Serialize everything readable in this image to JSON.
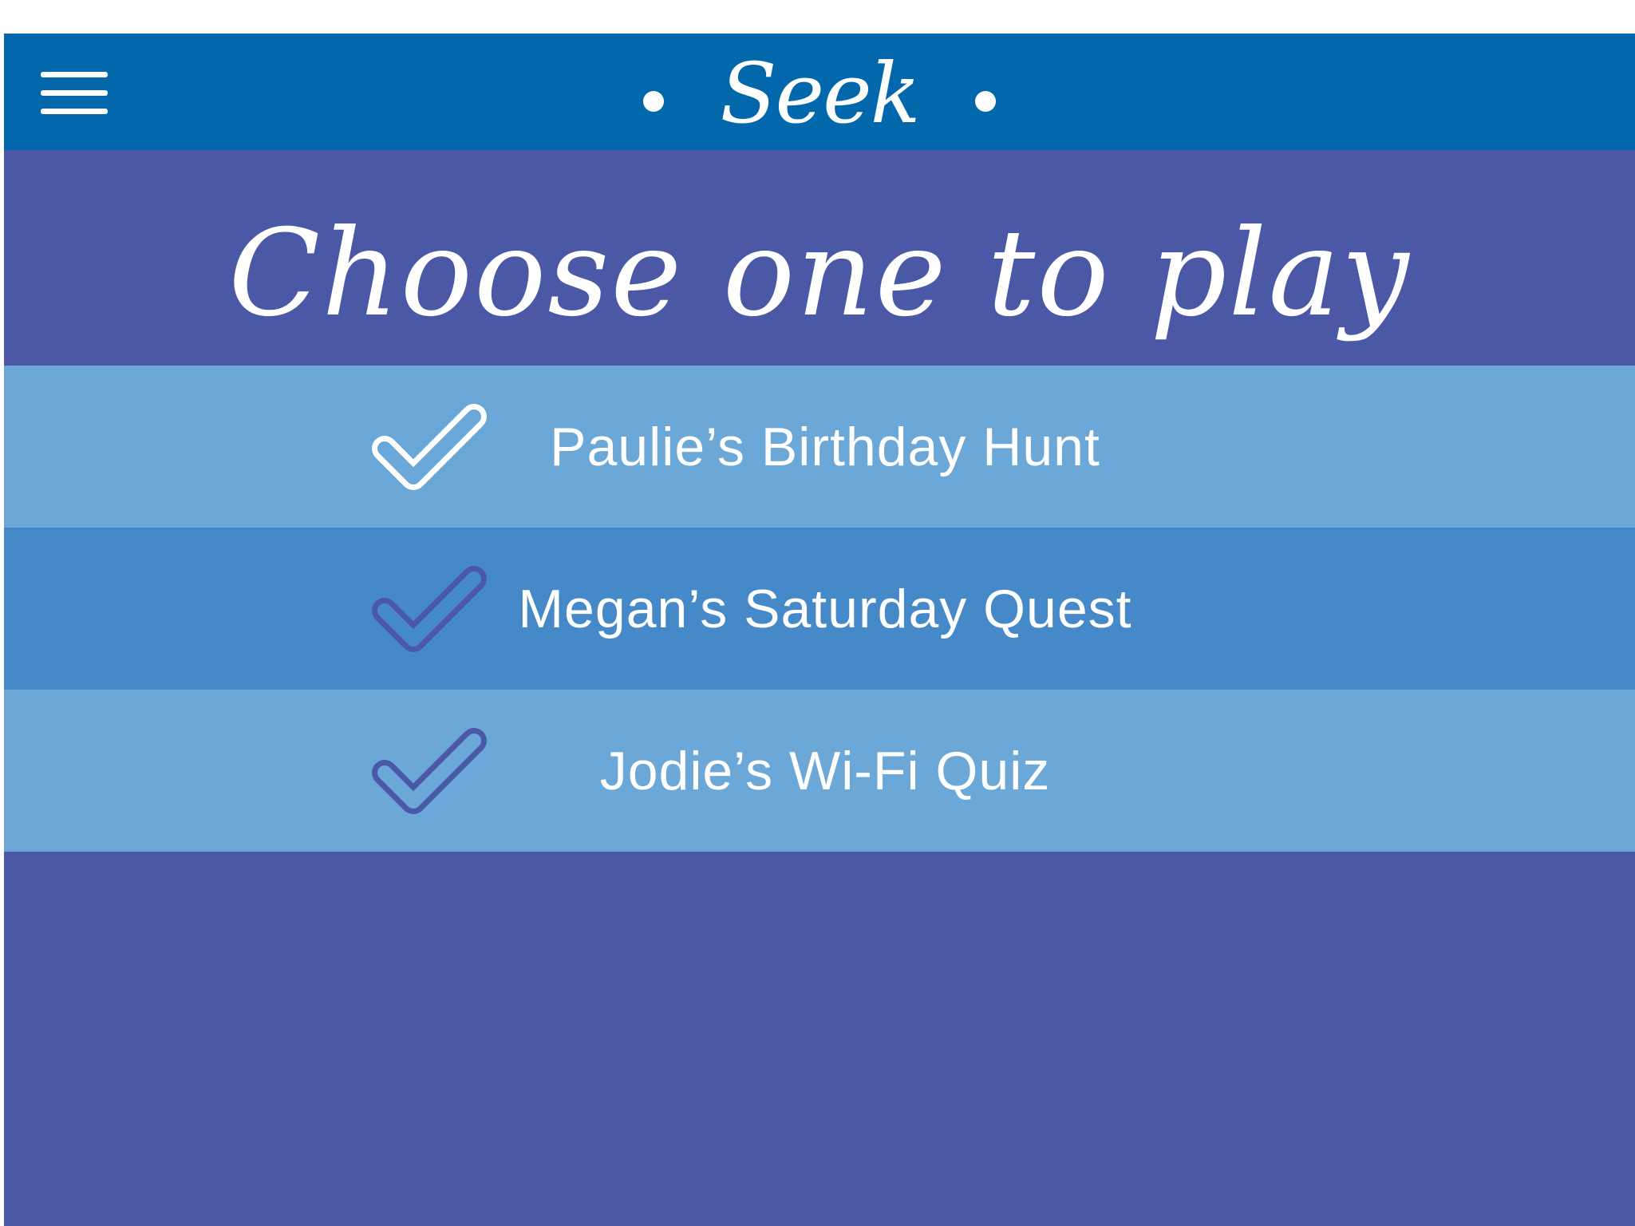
{
  "header": {
    "brand": "Seek",
    "menu_icon": "hamburger-menu-icon"
  },
  "main": {
    "title": "Choose one to play"
  },
  "games": [
    {
      "label": "Paulie’s Birthday Hunt",
      "icon": "checkmark-icon",
      "checked": true,
      "row_color": "#6ba8d8",
      "check_color": "#ffffff"
    },
    {
      "label": "Megan’s Saturday Quest",
      "icon": "checkmark-icon",
      "checked": false,
      "row_color": "#4689c8",
      "check_color": "#4a58a6"
    },
    {
      "label": "Jodie’s Wi-Fi Quiz",
      "icon": "checkmark-icon",
      "checked": false,
      "row_color": "#6ba8d8",
      "check_color": "#4a58a6"
    }
  ],
  "colors": {
    "topbar": "#0267ab",
    "background": "#4a58a6",
    "text": "#ffffff"
  }
}
